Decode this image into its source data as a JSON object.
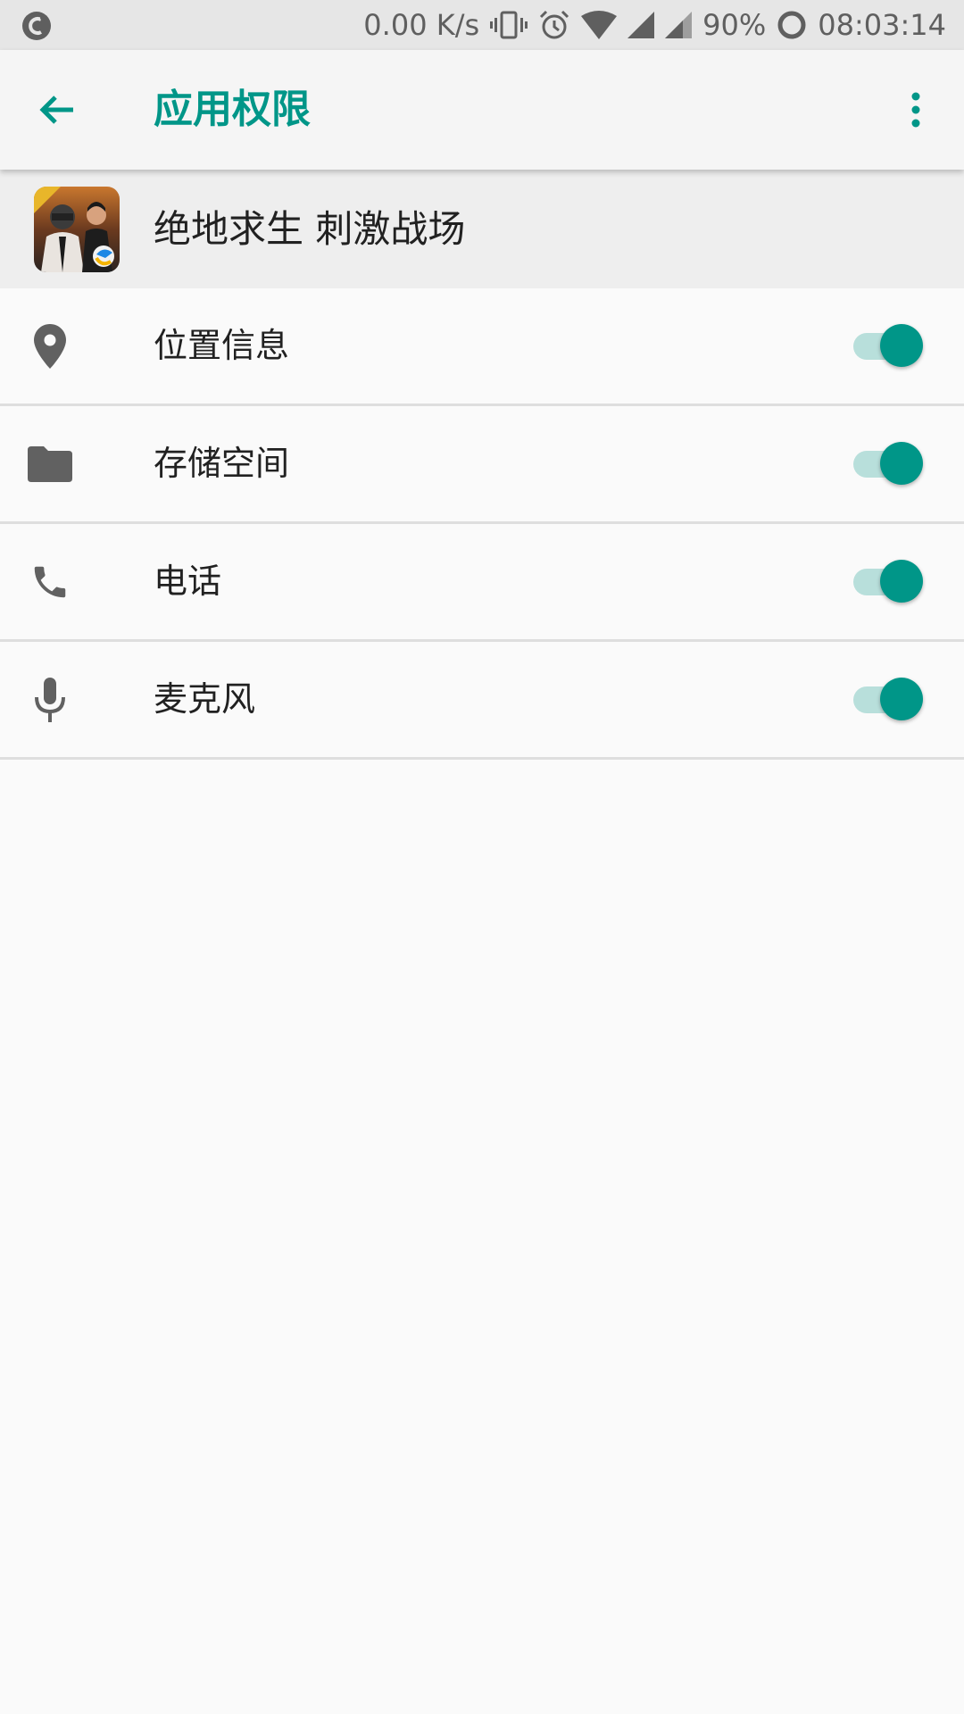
{
  "status_bar": {
    "network_speed": "0.00 K/s",
    "battery": "90%",
    "time": "08:03:14",
    "icons": [
      "app-notification-icon",
      "vibrate-icon",
      "alarm-icon",
      "wifi-icon",
      "signal-icon",
      "signal-icon-2",
      "battery-icon"
    ]
  },
  "appbar": {
    "title": "应用权限",
    "back_icon": "arrow-back-icon",
    "more_icon": "more-vert-icon"
  },
  "app": {
    "name": "绝地求生 刺激战场",
    "icon": "game-app-icon"
  },
  "permissions": [
    {
      "label": "位置信息",
      "icon": "location-icon",
      "enabled": true
    },
    {
      "label": "存储空间",
      "icon": "folder-icon",
      "enabled": true
    },
    {
      "label": "电话",
      "icon": "phone-icon",
      "enabled": true
    },
    {
      "label": "麦克风",
      "icon": "microphone-icon",
      "enabled": true
    }
  ],
  "colors": {
    "accent": "#009688",
    "toggle_track": "#b8dfdb",
    "icon_gray": "#616161"
  }
}
